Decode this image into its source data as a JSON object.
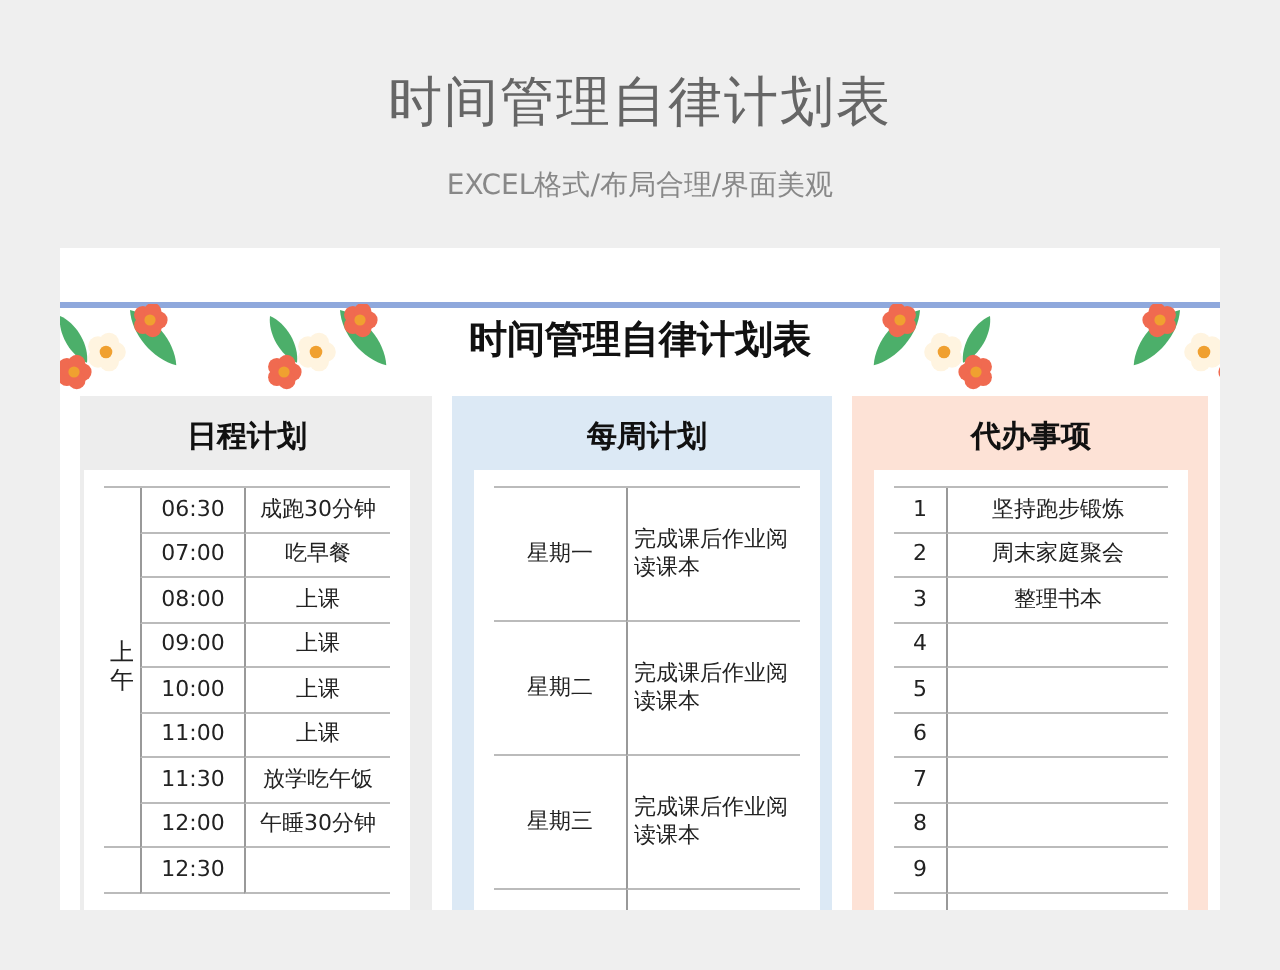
{
  "page": {
    "title": "时间管理自律计划表",
    "subtitle": "EXCEL格式/布局合理/界面美观"
  },
  "sheet": {
    "title": "时间管理自律计划表"
  },
  "daily_plan": {
    "title": "日程计划",
    "groups": [
      {
        "label": "上午",
        "rows": [
          {
            "time": "06:30",
            "activity": "成跑30分钟"
          },
          {
            "time": "07:00",
            "activity": "吃早餐"
          },
          {
            "time": "08:00",
            "activity": "上课"
          },
          {
            "time": "09:00",
            "activity": "上课"
          },
          {
            "time": "10:00",
            "activity": "上课"
          },
          {
            "time": "11:00",
            "activity": "上课"
          },
          {
            "time": "11:30",
            "activity": "放学吃午饭"
          },
          {
            "time": "12:00",
            "activity": "午睡30分钟"
          }
        ]
      },
      {
        "rows": [
          {
            "time": "12:30"
          }
        ]
      }
    ]
  },
  "weekly_plan": {
    "title": "每周计划",
    "rows": [
      {
        "day": "星期一",
        "task": "完成课后作业阅读课本"
      },
      {
        "day": "星期二",
        "task": "完成课后作业阅读课本"
      },
      {
        "day": "星期三",
        "task": "完成课后作业阅读课本"
      }
    ]
  },
  "todo": {
    "title": "代办事项",
    "rows": [
      {
        "number": "1",
        "item": "坚持跑步锻炼"
      },
      {
        "number": "2",
        "item": "周末家庭聚会"
      },
      {
        "number": "3",
        "item": "整理书本"
      },
      {
        "number": "4"
      },
      {
        "number": "5"
      },
      {
        "number": "6"
      },
      {
        "number": "7"
      },
      {
        "number": "8"
      },
      {
        "number": "9"
      }
    ]
  }
}
